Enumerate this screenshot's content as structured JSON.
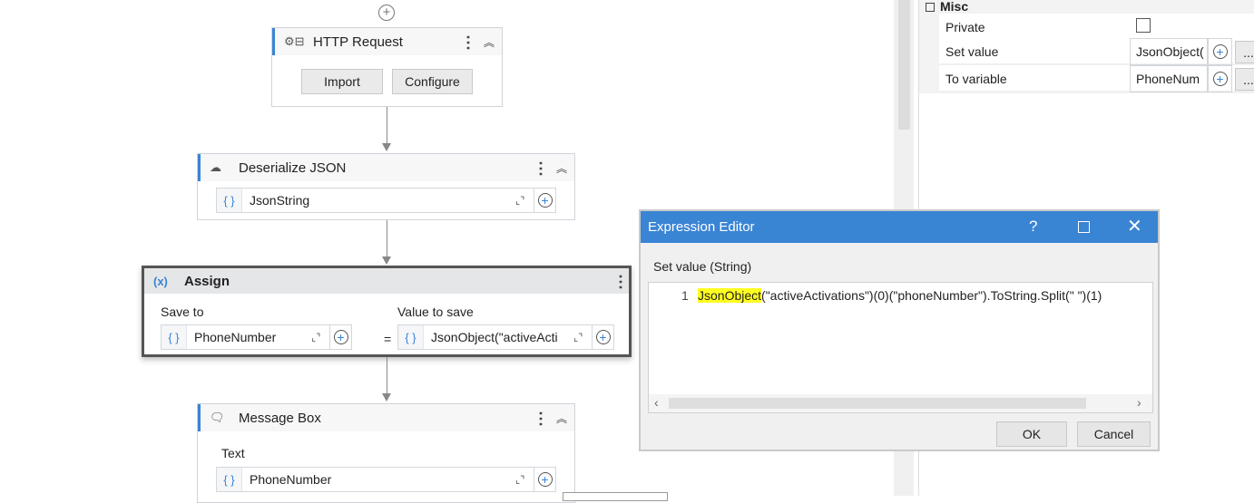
{
  "workflow": {
    "http": {
      "title": "HTTP Request",
      "import": "Import",
      "configure": "Configure"
    },
    "deserialize": {
      "title": "Deserialize JSON",
      "field": "JsonString"
    },
    "assign": {
      "title": "Assign",
      "save_to_label": "Save to",
      "value_label": "Value to save",
      "save_to": "PhoneNumber",
      "equals": "=",
      "value": "JsonObject(\"activeActi"
    },
    "message": {
      "title": "Message Box",
      "text_label": "Text",
      "text": "PhoneNumber"
    }
  },
  "properties": {
    "section": "Misc",
    "rows": [
      {
        "label": "Private"
      },
      {
        "label": "Set value",
        "value": "JsonObject(",
        "more": "..."
      },
      {
        "label": "To variable",
        "value": "PhoneNum",
        "more": "..."
      }
    ]
  },
  "dialog": {
    "title": "Expression Editor",
    "help": "?",
    "label": "Set value (String)",
    "line_number": "1",
    "code_highlight": "JsonObject",
    "code_rest": "(\"activeActivations\")(0)(\"phoneNumber\").ToString.Split(\" \")(1)",
    "ok": "OK",
    "cancel": "Cancel"
  }
}
